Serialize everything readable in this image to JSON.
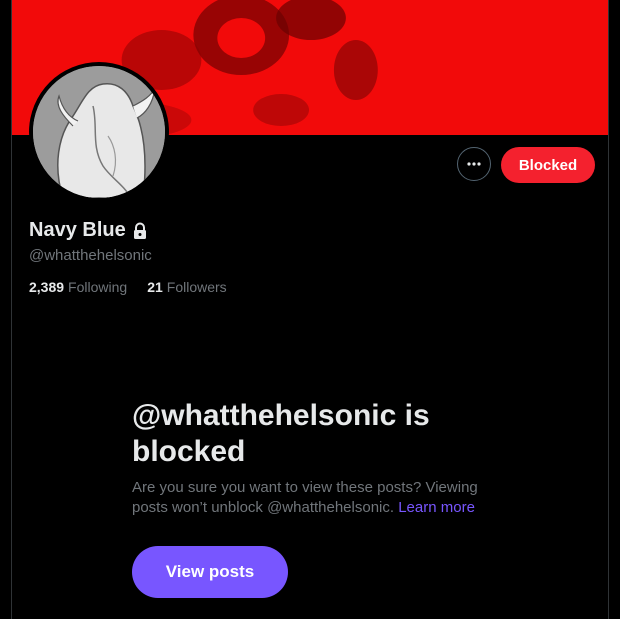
{
  "profile": {
    "display_name": "Navy Blue",
    "handle": "@whatthehelsonic",
    "lock_icon": "lock-icon",
    "following_count": "2,389",
    "following_label": "Following",
    "followers_count": "21",
    "followers_label": "Followers"
  },
  "actions": {
    "more_icon": "more-horizontal-icon",
    "blocked_label": "Blocked"
  },
  "blocked_notice": {
    "title": "@whatthehelsonic is blocked",
    "description": "Are you sure you want to view these posts? Viewing posts won’t unblock @whatthehelsonic.",
    "learn_more": "Learn more",
    "view_posts_label": "View posts"
  },
  "colors": {
    "banner": "#f20a0a",
    "blocked_button": "#f4212e",
    "accent": "#7856ff",
    "text_primary": "#e7e9ea",
    "text_secondary": "#71767b",
    "background": "#000000"
  }
}
